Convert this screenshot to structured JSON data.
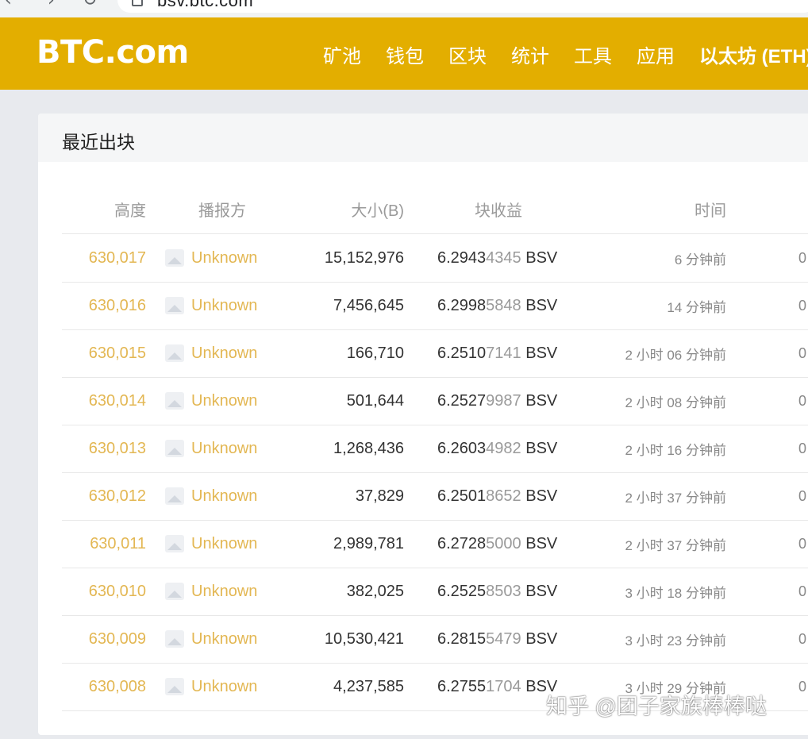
{
  "browser": {
    "url": "bsv.btc.com"
  },
  "header": {
    "logo": "BTC.com",
    "nav": [
      {
        "label": "矿池"
      },
      {
        "label": "钱包"
      },
      {
        "label": "区块"
      },
      {
        "label": "统计"
      },
      {
        "label": "工具"
      },
      {
        "label": "应用"
      },
      {
        "label": "以太坊 (ETH)"
      }
    ]
  },
  "colors": {
    "brand": "#e3ae00",
    "link": "#e3b753"
  },
  "recent_blocks": {
    "title": "最近出块",
    "columns": {
      "height": "高度",
      "miner": "播报方",
      "size": "大小(B)",
      "reward": "块收益",
      "time": "时间"
    },
    "rows": [
      {
        "height": "630,017",
        "miner": "Unknown",
        "size": "15,152,976",
        "reward_main": "6.2943",
        "reward_dim": "4345",
        "unit": " BSV",
        "time": "6 分钟前",
        "extra": "0"
      },
      {
        "height": "630,016",
        "miner": "Unknown",
        "size": "7,456,645",
        "reward_main": "6.2998",
        "reward_dim": "5848",
        "unit": " BSV",
        "time": "14 分钟前",
        "extra": "0"
      },
      {
        "height": "630,015",
        "miner": "Unknown",
        "size": "166,710",
        "reward_main": "6.2510",
        "reward_dim": "7141",
        "unit": " BSV",
        "time": "2 小时 06 分钟前",
        "extra": "0"
      },
      {
        "height": "630,014",
        "miner": "Unknown",
        "size": "501,644",
        "reward_main": "6.2527",
        "reward_dim": "9987",
        "unit": " BSV",
        "time": "2 小时 08 分钟前",
        "extra": "0"
      },
      {
        "height": "630,013",
        "miner": "Unknown",
        "size": "1,268,436",
        "reward_main": "6.2603",
        "reward_dim": "4982",
        "unit": " BSV",
        "time": "2 小时 16 分钟前",
        "extra": "0"
      },
      {
        "height": "630,012",
        "miner": "Unknown",
        "size": "37,829",
        "reward_main": "6.2501",
        "reward_dim": "8652",
        "unit": " BSV",
        "time": "2 小时 37 分钟前",
        "extra": "0"
      },
      {
        "height": "630,011",
        "miner": "Unknown",
        "size": "2,989,781",
        "reward_main": "6.2728",
        "reward_dim": "5000",
        "unit": " BSV",
        "time": "2 小时 37 分钟前",
        "extra": "0"
      },
      {
        "height": "630,010",
        "miner": "Unknown",
        "size": "382,025",
        "reward_main": "6.2525",
        "reward_dim": "8503",
        "unit": " BSV",
        "time": "3 小时 18 分钟前",
        "extra": "0"
      },
      {
        "height": "630,009",
        "miner": "Unknown",
        "size": "10,530,421",
        "reward_main": "6.2815",
        "reward_dim": "5479",
        "unit": " BSV",
        "time": "3 小时 23 分钟前",
        "extra": "0"
      },
      {
        "height": "630,008",
        "miner": "Unknown",
        "size": "4,237,585",
        "reward_main": "6.2755",
        "reward_dim": "1704",
        "unit": " BSV",
        "time": "3 小时 29 分钟前",
        "extra": "0"
      }
    ]
  },
  "watermark": "知乎 @团子家族棒棒哒"
}
